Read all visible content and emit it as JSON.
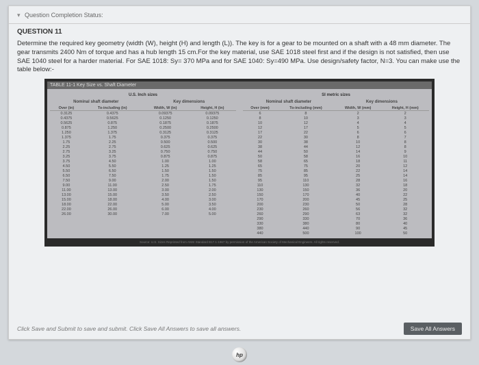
{
  "status_label": "Question Completion Status:",
  "question_number": "QUESTION 11",
  "prompt_text": "Determine the required key geometry (width (W), height (H) and length (L)). The key is for a gear to be mounted on a shaft with a 48 mm diameter. The gear transmits 2400 Nm of torque and has a hub length 15 cm.For the key material, use SAE 1018 steel first and if the design is not satisfied, then use SAE 1040 steel for a harder material.  For SAE 1018: Sy= 370 MPa and for SAE 1040: Sy=490 MPa.  Use design/safety factor, N=3.  You can make use the table below:-",
  "table_title": "TABLE 11-1   Key Size vs. Shaft Diameter",
  "units_left": "U.S. Inch sizes",
  "units_right": "SI metric sizes",
  "group_left": "Nominal shaft diameter",
  "group_key": "Key dimensions",
  "headers_us": [
    "Over (in)",
    "To-including (in)",
    "Width, W (in)",
    "Height, H (in)"
  ],
  "headers_si": [
    "Over (mm)",
    "To-including (mm)",
    "Width, W (mm)",
    "Height, H (mm)"
  ],
  "chart_data": {
    "type": "table",
    "us_rows": [
      [
        "0.3125",
        "0.4375",
        "0.09375",
        "0.09375"
      ],
      [
        "0.4375",
        "0.5625",
        "0.1250",
        "0.1250"
      ],
      [
        "0.5625",
        "0.875",
        "0.1875",
        "0.1875"
      ],
      [
        "0.875",
        "1.250",
        "0.2500",
        "0.2500"
      ],
      [
        "1.250",
        "1.375",
        "0.3125",
        "0.3125"
      ],
      [
        "1.375",
        "1.75",
        "0.375",
        "0.375"
      ],
      [
        "1.75",
        "2.25",
        "0.500",
        "0.500"
      ],
      [
        "2.25",
        "2.75",
        "0.625",
        "0.625"
      ],
      [
        "2.75",
        "3.25",
        "0.750",
        "0.750"
      ],
      [
        "3.25",
        "3.75",
        "0.875",
        "0.875"
      ],
      [
        "3.75",
        "4.50",
        "1.00",
        "1.00"
      ],
      [
        "4.50",
        "5.50",
        "1.25",
        "1.25"
      ],
      [
        "5.50",
        "6.50",
        "1.50",
        "1.50"
      ],
      [
        "6.50",
        "7.50",
        "1.75",
        "1.50"
      ],
      [
        "7.50",
        "9.00",
        "2.00",
        "1.50"
      ],
      [
        "9.00",
        "11.00",
        "2.50",
        "1.75"
      ],
      [
        "11.00",
        "13.00",
        "3.00",
        "2.00"
      ],
      [
        "13.00",
        "15.00",
        "3.50",
        "2.50"
      ],
      [
        "15.00",
        "18.00",
        "4.00",
        "3.00"
      ],
      [
        "18.00",
        "22.00",
        "5.00",
        "3.50"
      ],
      [
        "22.00",
        "26.00",
        "6.00",
        "4.00"
      ],
      [
        "26.00",
        "30.00",
        "7.00",
        "5.00"
      ]
    ],
    "si_rows": [
      [
        "6",
        "8",
        "2",
        "2"
      ],
      [
        "8",
        "10",
        "3",
        "3"
      ],
      [
        "10",
        "12",
        "4",
        "4"
      ],
      [
        "12",
        "17",
        "5",
        "5"
      ],
      [
        "17",
        "22",
        "6",
        "6"
      ],
      [
        "22",
        "30",
        "8",
        "7"
      ],
      [
        "30",
        "38",
        "10",
        "8"
      ],
      [
        "38",
        "44",
        "12",
        "8"
      ],
      [
        "44",
        "50",
        "14",
        "9"
      ],
      [
        "50",
        "58",
        "16",
        "10"
      ],
      [
        "58",
        "65",
        "18",
        "11"
      ],
      [
        "65",
        "75",
        "20",
        "12"
      ],
      [
        "75",
        "85",
        "22",
        "14"
      ],
      [
        "85",
        "95",
        "25",
        "14"
      ],
      [
        "95",
        "110",
        "28",
        "16"
      ],
      [
        "110",
        "130",
        "32",
        "18"
      ],
      [
        "130",
        "150",
        "36",
        "20"
      ],
      [
        "150",
        "170",
        "40",
        "22"
      ],
      [
        "170",
        "200",
        "45",
        "25"
      ],
      [
        "200",
        "230",
        "50",
        "28"
      ],
      [
        "230",
        "260",
        "56",
        "32"
      ],
      [
        "260",
        "290",
        "63",
        "32"
      ],
      [
        "290",
        "330",
        "70",
        "36"
      ],
      [
        "330",
        "380",
        "80",
        "40"
      ],
      [
        "380",
        "440",
        "90",
        "45"
      ],
      [
        "440",
        "500",
        "100",
        "50"
      ]
    ]
  },
  "source_note": "Source: U.S. Sizes Reprinted from ANSI Standard B17.1-1967 by permission of the American Society of Mechanical Engineers. All rights reserved.",
  "bottom_hint": "Click Save and Submit to save and submit. Click Save All Answers to save all answers.",
  "save_button": "Save All Answers",
  "logo": "hp"
}
